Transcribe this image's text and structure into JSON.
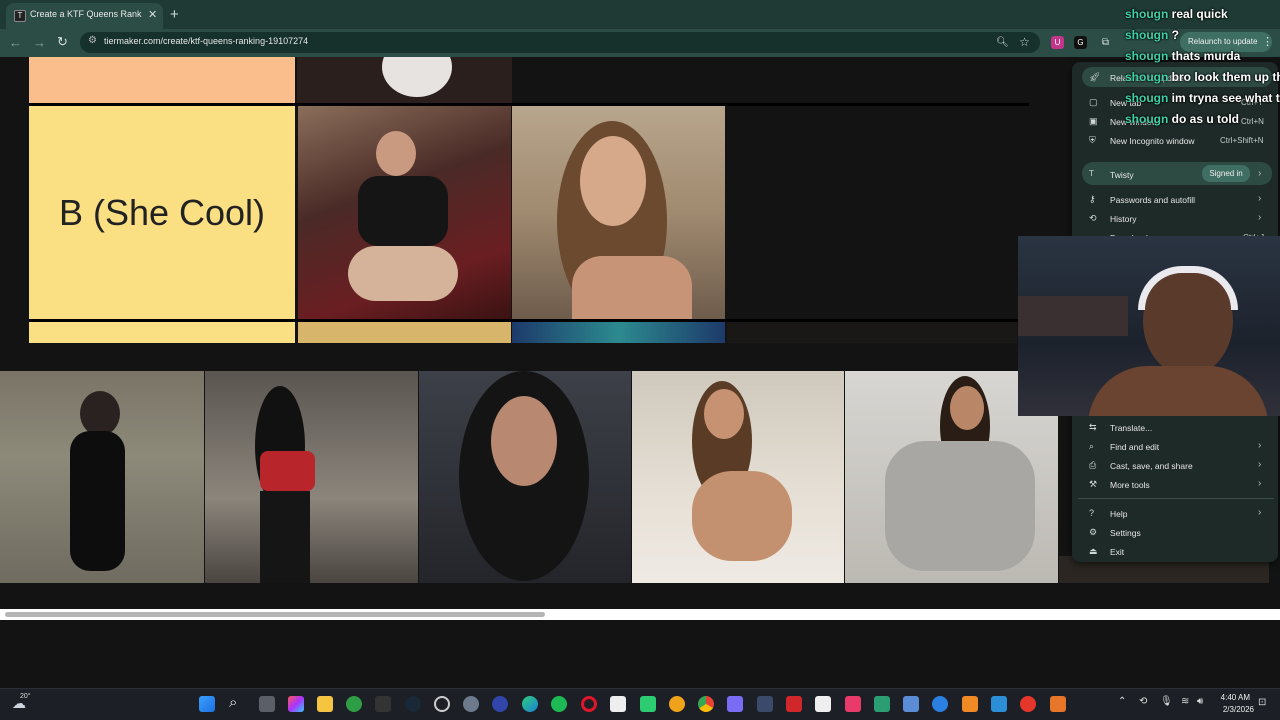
{
  "browser": {
    "tab_title": "Create a KTF Queens Ranking",
    "tab_close": "✕",
    "new_tab": "+",
    "url": "tiermaker.com/create/ktf-queens-ranking-19107274",
    "relaunch_label": "Relaunch to update",
    "profile_initial": "G"
  },
  "tiers": {
    "b_label": "B (She Cool)"
  },
  "menu": {
    "relaunch": "Relaunch to update",
    "items": [
      {
        "label": "New tab",
        "shortcut": "Ctrl+T"
      },
      {
        "label": "New window",
        "shortcut": "Ctrl+N"
      },
      {
        "label": "New Incognito window",
        "shortcut": "Ctrl+Shift+N"
      }
    ],
    "profile_name": "Twisty",
    "profile_initial": "T",
    "profile_status": "Signed in",
    "passwords": "Passwords and autofill",
    "history": "History",
    "downloads": "Downloads",
    "downloads_shortcut": "Ctrl+J",
    "translate": "Translate...",
    "find_edit": "Find and edit",
    "cast": "Cast, save, and share",
    "more_tools": "More tools",
    "help": "Help",
    "settings": "Settings",
    "exit": "Exit"
  },
  "chat": [
    {
      "user": "shougn",
      "message": "real quick"
    },
    {
      "user": "shougn",
      "message": "?"
    },
    {
      "user": "shougn",
      "message": "thats murda"
    },
    {
      "user": "shougn",
      "message": "bro look them up the"
    },
    {
      "user": "shougn",
      "message": "im tryna see what the"
    },
    {
      "user": "shougn",
      "message": "do as u told"
    }
  ],
  "taskbar": {
    "weather": "20°",
    "time": "4:40 AM",
    "date": "2/3/2026"
  },
  "colors": {
    "tier_a": "#f9be8b",
    "tier_b": "#fadf83",
    "chat_user": "#3fd0a6",
    "browser_frame": "#2b4d45"
  }
}
